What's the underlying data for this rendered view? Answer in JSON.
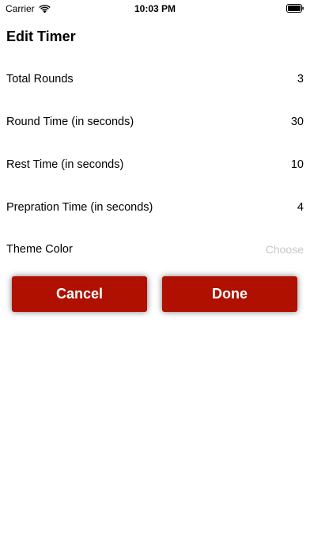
{
  "status_bar": {
    "carrier": "Carrier",
    "time": "10:03 PM"
  },
  "title": "Edit Timer",
  "rows": [
    {
      "label": "Total Rounds",
      "value": "3"
    },
    {
      "label": "Round Time (in seconds)",
      "value": "30"
    },
    {
      "label": "Rest Time (in seconds)",
      "value": "10"
    },
    {
      "label": "Prepration Time (in seconds)",
      "value": "4"
    }
  ],
  "theme_color": {
    "label": "Theme Color",
    "placeholder": "Choose"
  },
  "buttons": {
    "cancel": "Cancel",
    "done": "Done"
  },
  "colors": {
    "button_background": "#b01000",
    "button_text": "#ffffff",
    "placeholder": "#c7c7cd"
  }
}
